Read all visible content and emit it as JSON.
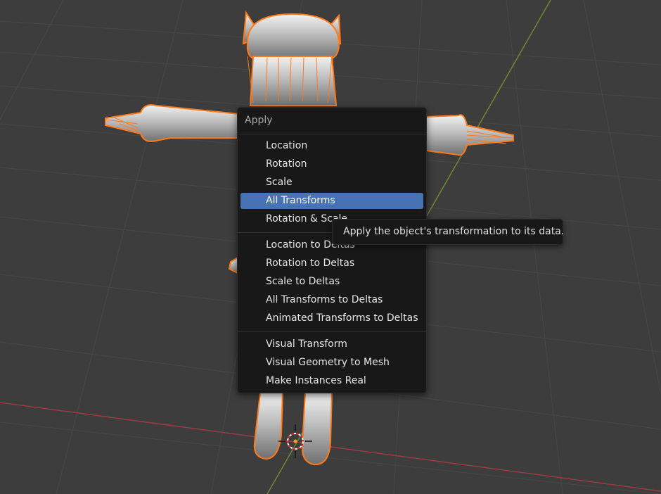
{
  "menu": {
    "title": "Apply",
    "groups": [
      {
        "items": [
          {
            "label": "Location"
          },
          {
            "label": "Rotation"
          },
          {
            "label": "Scale"
          },
          {
            "label": "All Transforms",
            "active": true
          },
          {
            "label": "Rotation & Scale"
          }
        ]
      },
      {
        "items": [
          {
            "label": "Location to Deltas"
          },
          {
            "label": "Rotation to Deltas"
          },
          {
            "label": "Scale to Deltas"
          },
          {
            "label": "All Transforms to Deltas"
          },
          {
            "label": "Animated Transforms to Deltas"
          }
        ]
      },
      {
        "items": [
          {
            "label": "Visual Transform"
          },
          {
            "label": "Visual Geometry to Mesh"
          },
          {
            "label": "Make Instances Real"
          }
        ]
      }
    ]
  },
  "tooltip": {
    "text": "Apply the object's transformation to its data."
  },
  "colors": {
    "viewport_bg": "#3d3d3d",
    "grid": "#474747",
    "x_axis": "#9c3a46",
    "y_axis": "#6a8a32",
    "selection_outline": "#ff7a1a",
    "menu_bg": "#181818",
    "active_item": "#4772b3"
  },
  "icons": [
    "3d-cursor-icon"
  ]
}
